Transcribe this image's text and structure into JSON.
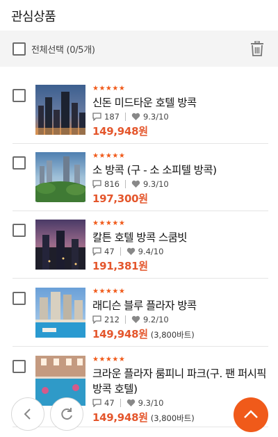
{
  "header": {
    "title": "관심상품"
  },
  "toolbar": {
    "select_all_label": "전체선택 (0/5개)"
  },
  "items": [
    {
      "stars": "★★★★★",
      "name": "신돈 미드타운 호텔 방콕",
      "reviews": "187",
      "rating": "9.3/10",
      "price": "149,948원",
      "sub_price": ""
    },
    {
      "stars": "★★★★★",
      "name": "소 방콕 (구 - 소 소피텔 방콕)",
      "reviews": "816",
      "rating": "9.3/10",
      "price": "197,300원",
      "sub_price": ""
    },
    {
      "stars": "★★★★★",
      "name": "칼튼 호텔 방콕 스쿰빗",
      "reviews": "47",
      "rating": "9.4/10",
      "price": "191,381원",
      "sub_price": ""
    },
    {
      "stars": "★★★★★",
      "name": "래디슨 블루 플라자 방콕",
      "reviews": "212",
      "rating": "9.2/10",
      "price": "149,948원",
      "sub_price": "(3,800바트)"
    },
    {
      "stars": "★★★★★",
      "name": "크라운 플라자 룸피니 파크(구. 팬 퍼시픽 방콕 호텔)",
      "reviews": "47",
      "rating": "9.3/10",
      "price": "149,948원",
      "sub_price": "(3,800바트)"
    }
  ],
  "colors": {
    "accent": "#f05a1a",
    "price": "#e4562c",
    "toolbar_bg": "#f4f4f4"
  },
  "icons": {
    "trash": "trash-icon",
    "back": "chevron-left-icon",
    "refresh": "refresh-icon",
    "top": "chevron-up-icon"
  }
}
